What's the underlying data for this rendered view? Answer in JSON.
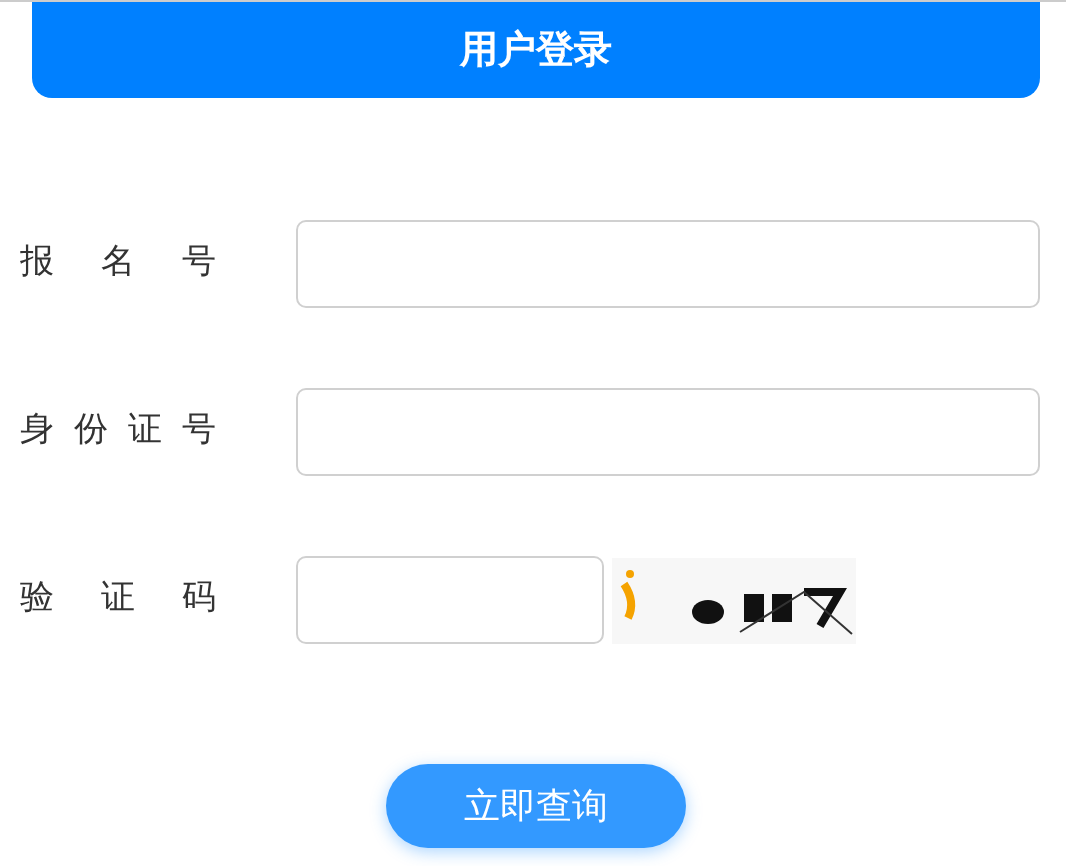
{
  "header": {
    "title": "用户登录"
  },
  "fields": [
    {
      "label": "报名号",
      "kind": "text"
    },
    {
      "label": "身份证号",
      "kind": "text"
    },
    {
      "label": "验证码",
      "kind": "captcha"
    }
  ],
  "submit": {
    "label": "立即查询"
  }
}
